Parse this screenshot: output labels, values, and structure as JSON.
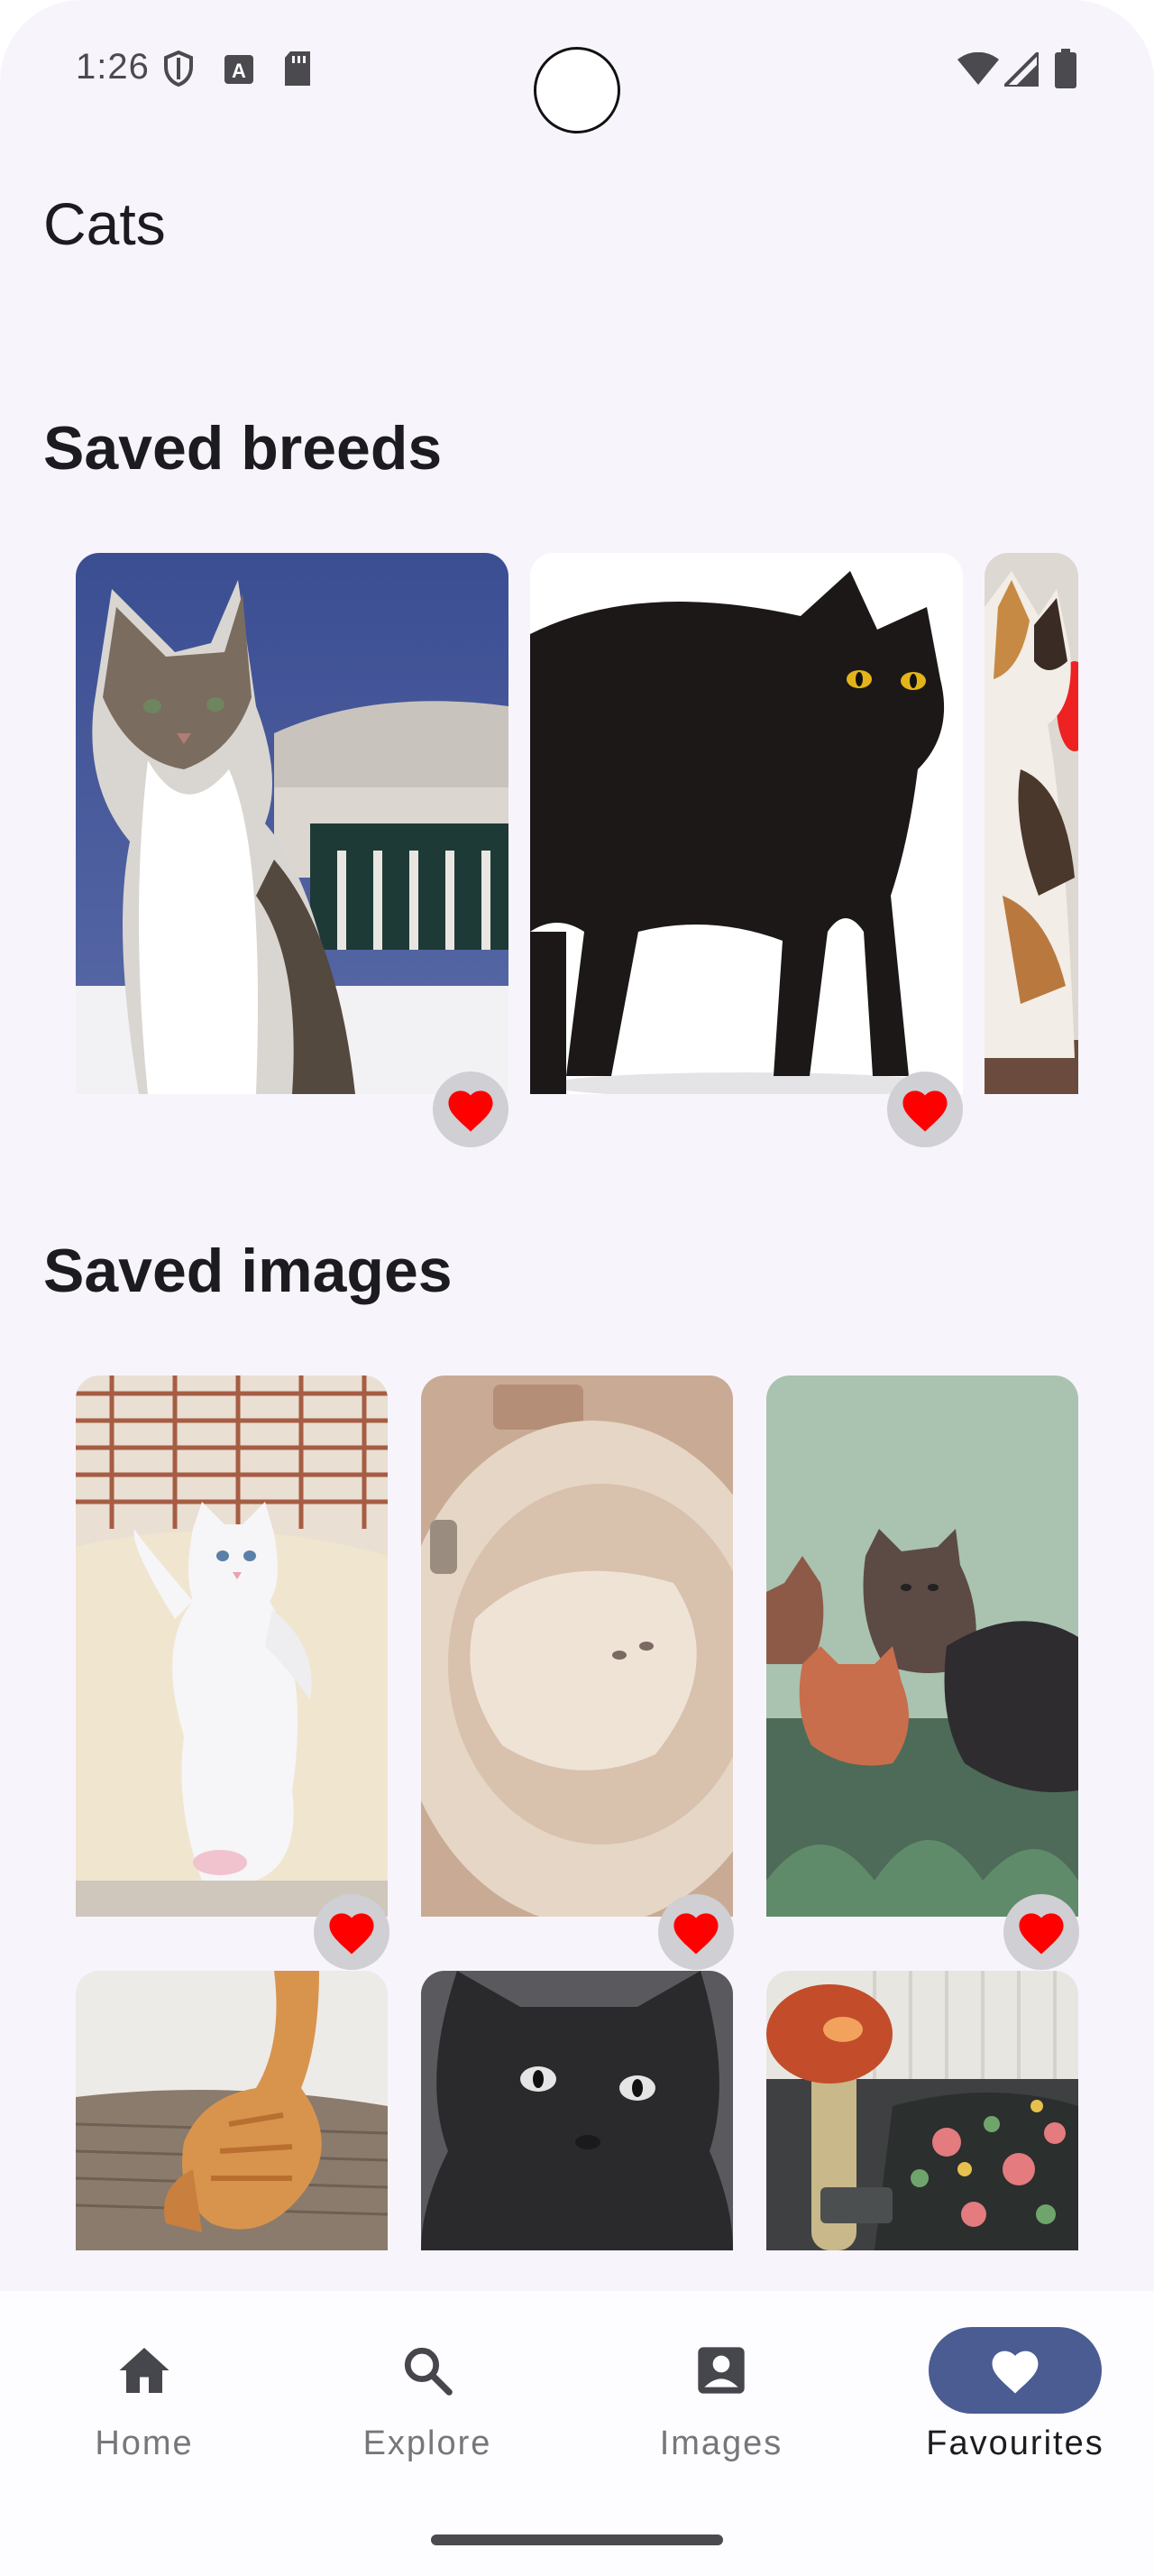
{
  "status_bar": {
    "time": "1:26",
    "icons": [
      "shield-icon",
      "a-badge-icon",
      "sd-card-icon",
      "wifi-icon",
      "signal-icon",
      "battery-icon"
    ]
  },
  "app": {
    "title": "Cats"
  },
  "sections": {
    "saved_breeds": "Saved breeds",
    "saved_images": "Saved images"
  },
  "breeds": [
    {
      "image": "tabby-white-cat-photo",
      "favourited": true
    },
    {
      "image": "black-cat-photo",
      "favourited": true
    },
    {
      "image": "calico-cat-photo",
      "favourited": true
    }
  ],
  "images": [
    {
      "image": "white-kitten-standing-photo",
      "favourited": true
    },
    {
      "image": "cat-in-sink-photo",
      "favourited": true
    },
    {
      "image": "kittens-in-grass-photo",
      "favourited": true
    },
    {
      "image": "orange-kitten-photo",
      "favourited": false
    },
    {
      "image": "black-fluffy-cat-photo",
      "favourited": false
    },
    {
      "image": "mushroom-lamp-rug-photo",
      "favourited": false
    }
  ],
  "bottom_nav": {
    "items": [
      {
        "label": "Home",
        "icon": "home-icon",
        "active": false
      },
      {
        "label": "Explore",
        "icon": "search-icon",
        "active": false
      },
      {
        "label": "Images",
        "icon": "account-box-icon",
        "active": false
      },
      {
        "label": "Favourites",
        "icon": "heart-icon",
        "active": true
      }
    ]
  },
  "colors": {
    "background": "#f7f5fb",
    "heart": "#ff0000",
    "nav_active_pill": "#4a5c92",
    "badge_bg": "#cfcfd4",
    "text_primary": "#1c1b1f",
    "text_secondary": "#77767b"
  }
}
